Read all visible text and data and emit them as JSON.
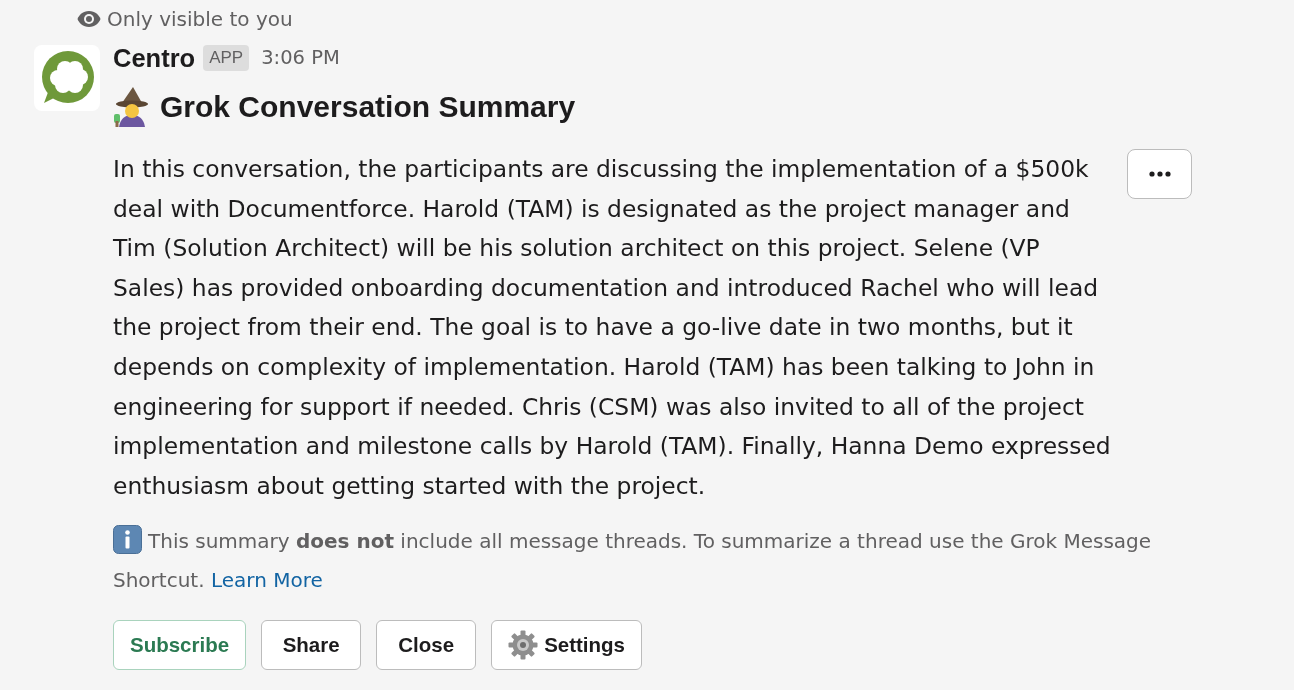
{
  "visibility_note": "Only visible to you",
  "message": {
    "sender": "Centro",
    "badge": "APP",
    "time": "3:06 PM"
  },
  "summary": {
    "title": "Grok Conversation Summary",
    "text": "In this conversation, the participants are discussing the implementation of a $500k deal with Documentforce. Harold (TAM) is designated as the project manager and Tim (Solution Architect) will be his solution architect on this project. Selene (VP Sales) has provided onboarding documentation and introduced Rachel who will lead the project from their end. The goal is to have a go-live date in two months, but it depends on complexity of implementation. Harold (TAM) has been talking to John in engineering for support if needed. Chris (CSM) was also invited to all of the project implementation and milestone calls by Harold (TAM). Finally, Hanna Demo expressed enthusiasm about getting started with the project.",
    "note": "This summary **does not** include all message threads. To summarize a thread use the Grok Message Shortcut.",
    "link": "Learn More"
  },
  "actions": [
    {
      "label": "Subscribe",
      "kind": "primary"
    },
    {
      "label": "Share",
      "kind": "plain"
    },
    {
      "label": "Close",
      "kind": "plain"
    },
    {
      "label": "Settings",
      "kind": "gear"
    }
  ]
}
